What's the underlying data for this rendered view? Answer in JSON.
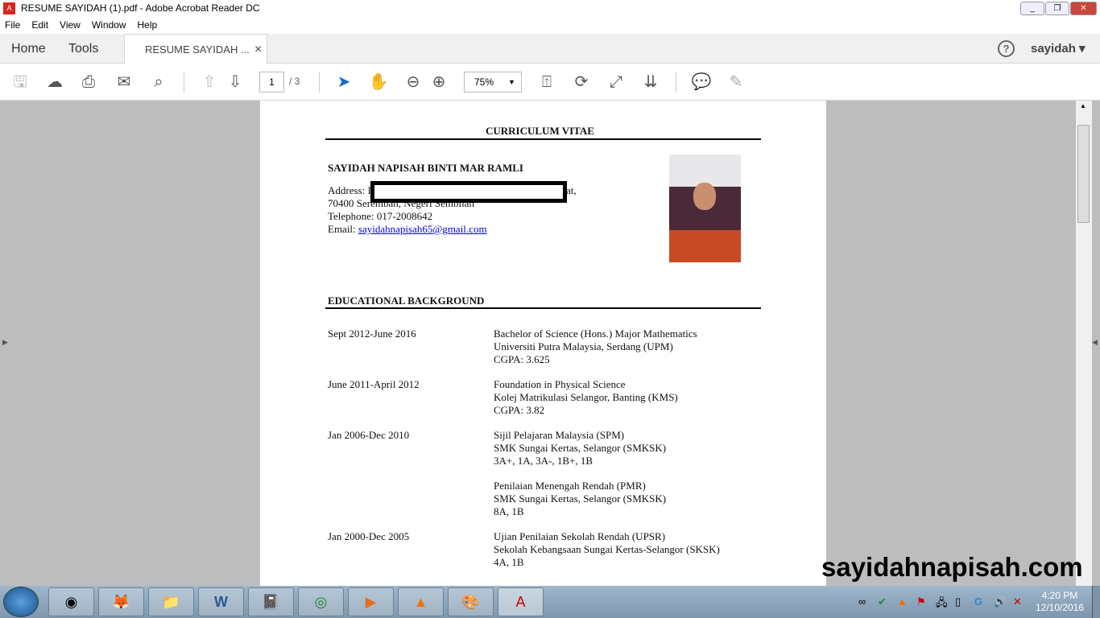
{
  "window": {
    "title": "RESUME SAYIDAH (1).pdf - Adobe Acrobat Reader DC",
    "minimize": "_",
    "restore": "❐",
    "close": "✕"
  },
  "menu": [
    "File",
    "Edit",
    "View",
    "Window",
    "Help"
  ],
  "tabs": {
    "home": "Home",
    "tools": "Tools",
    "document": "RESUME SAYIDAH ...",
    "close": "×"
  },
  "user": {
    "help": "?",
    "name": "sayidah",
    "chevron": "▾"
  },
  "toolbar": {
    "page_current": "1",
    "page_total": "/ 3",
    "zoom": "75%"
  },
  "document": {
    "title": "CURRICULUM VITAE",
    "name": "SAYIDAH NAPISAH BINTI MAR RAMLI",
    "address_label": "Address: I",
    "address_tail": "at,",
    "address_line2": "70400 Seremban, Negeri Sembilan",
    "telephone": "Telephone:  017-2008642",
    "email_label": "Email:",
    "email": "sayidahnapisah65@gmail.com",
    "section": "EDUCATIONAL BACKGROUND",
    "education": [
      {
        "date": "Sept 2012-June 2016",
        "lines": [
          "Bachelor of Science (Hons.) Major Mathematics",
          "Universiti Putra Malaysia, Serdang (UPM)",
          "CGPA: 3.625"
        ]
      },
      {
        "date": "June 2011-April 2012",
        "lines": [
          "Foundation in Physical Science",
          "Kolej Matrikulasi Selangor, Banting (KMS)",
          "CGPA: 3.82"
        ]
      },
      {
        "date": "Jan 2006-Dec 2010",
        "lines": [
          "Sijil Pelajaran Malaysia (SPM)",
          "SMK Sungai Kertas, Selangor (SMKSK)",
          "3A+, 1A, 3A-, 1B+, 1B"
        ]
      },
      {
        "date": "",
        "lines": [
          "Penilaian Menengah Rendah (PMR)",
          "SMK Sungai Kertas, Selangor (SMKSK)",
          "8A, 1B"
        ]
      },
      {
        "date": "Jan 2000-Dec 2005",
        "lines": [
          "Ujian Penilaian Sekolah Rendah (UPSR)",
          "Sekolah Kebangsaan Sungai Kertas-Selangor (SKSK)",
          "4A, 1B"
        ]
      }
    ]
  },
  "watermark": "sayidahnapisah.com",
  "clock": {
    "time": "4:20 PM",
    "date": "12/10/2016"
  }
}
